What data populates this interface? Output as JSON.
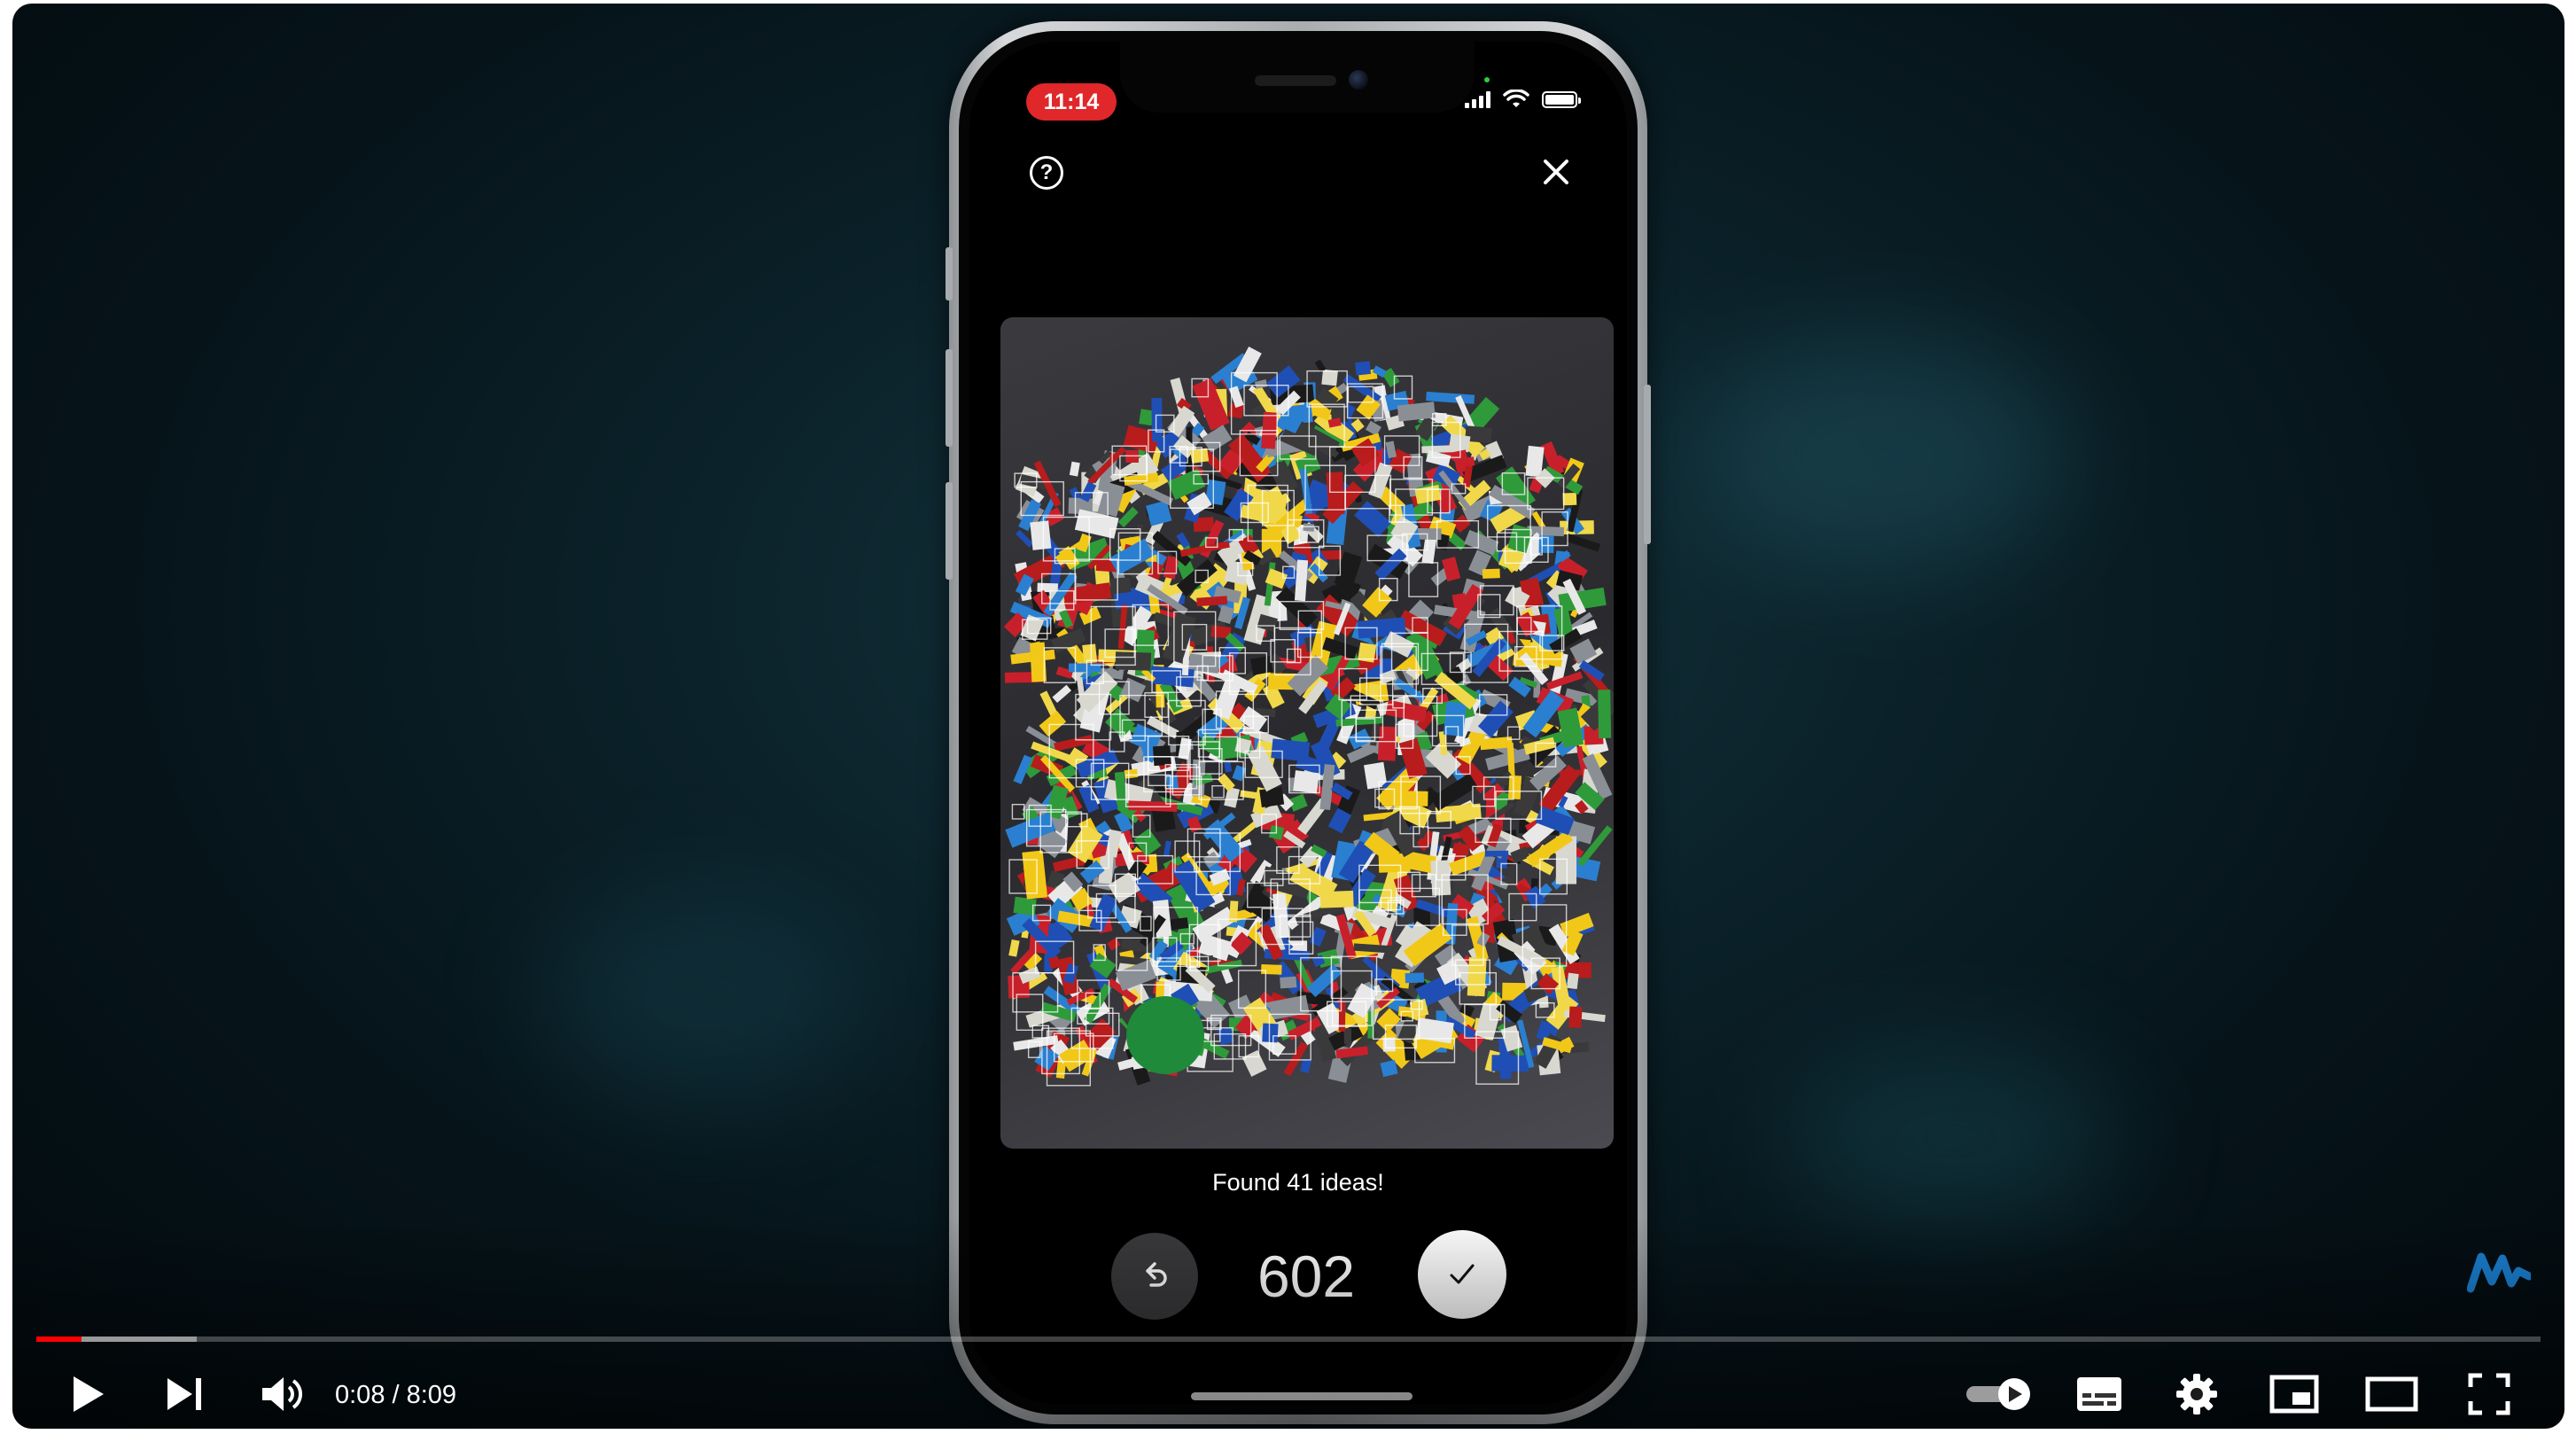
{
  "app": {
    "name": "Video player"
  },
  "phone": {
    "status_time": "11:14",
    "help_icon_glyph": "?",
    "photo_description_icon": "photo-icon",
    "found_text": "Found 41 ideas!",
    "piece_count": "602",
    "accent_time_pill": "#e0272a"
  },
  "player": {
    "time_display": "0:08 / 8:09",
    "progress": {
      "played_fraction": 0.018,
      "loaded_fraction": 0.064
    },
    "colors": {
      "played": "#ff0000",
      "background": "#0b2129"
    },
    "controls": [
      "play-icon",
      "next-icon",
      "volume-icon",
      "autoplay-toggle-icon",
      "subtitles-icon",
      "settings-icon",
      "miniplayer-icon",
      "theater-mode-icon",
      "fullscreen-icon"
    ]
  }
}
